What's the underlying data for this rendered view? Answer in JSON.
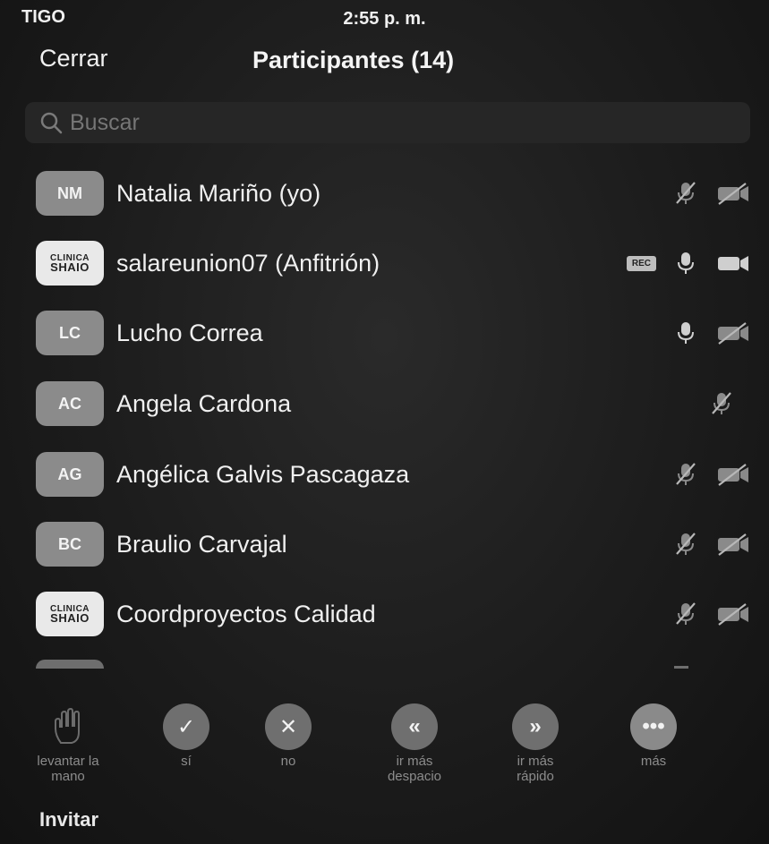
{
  "status_bar": {
    "carrier": "TIGO",
    "time": "2:55 p. m."
  },
  "header": {
    "close_label": "Cerrar",
    "title": "Participantes (14)"
  },
  "search": {
    "placeholder": "Buscar"
  },
  "participants": [
    {
      "initials": "NM",
      "name": "Natalia Mariño (yo)",
      "avatar": "initials",
      "mic": "muted",
      "video": "off",
      "rec": false
    },
    {
      "initials": "SHAIO",
      "name": "salareunion07 (Anfitrión)",
      "avatar": "logo",
      "mic": "on",
      "video": "on",
      "rec": true,
      "rec_label": "REC"
    },
    {
      "initials": "LC",
      "name": "Lucho Correa",
      "avatar": "initials",
      "mic": "on",
      "video": "off",
      "rec": false
    },
    {
      "initials": "AC",
      "name": "Angela Cardona",
      "avatar": "initials",
      "mic": "muted",
      "video": "none",
      "rec": false
    },
    {
      "initials": "AG",
      "name": "Angélica Galvis Pascagaza",
      "avatar": "initials",
      "mic": "muted",
      "video": "off",
      "rec": false
    },
    {
      "initials": "BC",
      "name": "Braulio Carvajal",
      "avatar": "initials",
      "mic": "muted",
      "video": "off",
      "rec": false
    },
    {
      "initials": "SHAIO",
      "name": "Coordproyectos Calidad",
      "avatar": "logo",
      "mic": "muted",
      "video": "off",
      "rec": false
    }
  ],
  "logo_text": {
    "line1": "CLINICA",
    "line2": "SHAIO"
  },
  "reactions": [
    {
      "name": "raise-hand",
      "icon": "hand-icon",
      "label_1": "levantar la",
      "label_2": "mano",
      "symbol": "",
      "color": "transparent"
    },
    {
      "name": "yes",
      "icon": "check-icon",
      "label_1": "sí",
      "label_2": "",
      "symbol": "✓",
      "color": "#6f6f6f"
    },
    {
      "name": "no",
      "icon": "x-icon",
      "label_1": "no",
      "label_2": "",
      "symbol": "✕",
      "color": "#6f6f6f"
    },
    {
      "name": "go-slower",
      "icon": "rewind-icon",
      "label_1": "ir más",
      "label_2": "despacio",
      "symbol": "«",
      "color": "#6f6f6f"
    },
    {
      "name": "go-faster",
      "icon": "fast-forward-icon",
      "label_1": "ir más",
      "label_2": "rápido",
      "symbol": "»",
      "color": "#6f6f6f"
    },
    {
      "name": "more",
      "icon": "ellipsis-icon",
      "label_1": "más",
      "label_2": "",
      "symbol": "•••",
      "color": "#8a8a8a"
    }
  ],
  "footer": {
    "invite_label": "Invitar"
  }
}
